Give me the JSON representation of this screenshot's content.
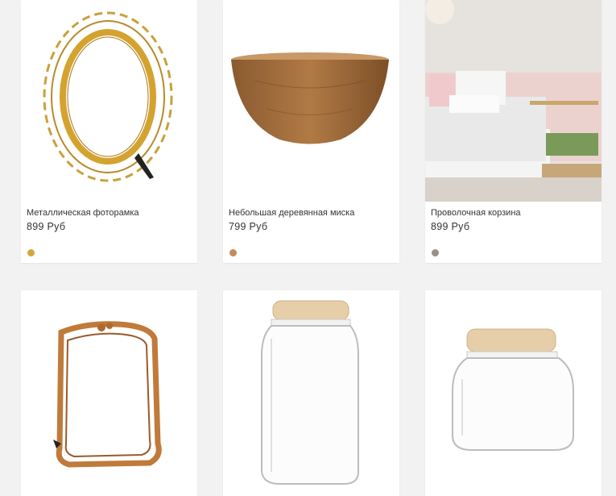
{
  "products": [
    {
      "name": "Металлическая фоторамка",
      "price": "899 Руб",
      "swatch_color": "#d4a63a",
      "image": "gold-rattan-photo-frame"
    },
    {
      "name": "Небольшая деревянная миска",
      "price": "799 Руб",
      "swatch_color": "#c38a5c",
      "image": "wooden-bowl"
    },
    {
      "name": "Проволочная корзина",
      "price": "899 Руб",
      "swatch_color": "#9a8f88",
      "image": "bedroom-scene"
    },
    {
      "name": "",
      "price": "",
      "swatch_color": "#b07a3c",
      "image": "ornate-copper-frame"
    },
    {
      "name": "",
      "price": "",
      "swatch_color": "#d9c4a2",
      "image": "tall-glass-jar"
    },
    {
      "name": "",
      "price": "",
      "swatch_color": "#d9c4a2",
      "image": "short-glass-jar"
    }
  ]
}
